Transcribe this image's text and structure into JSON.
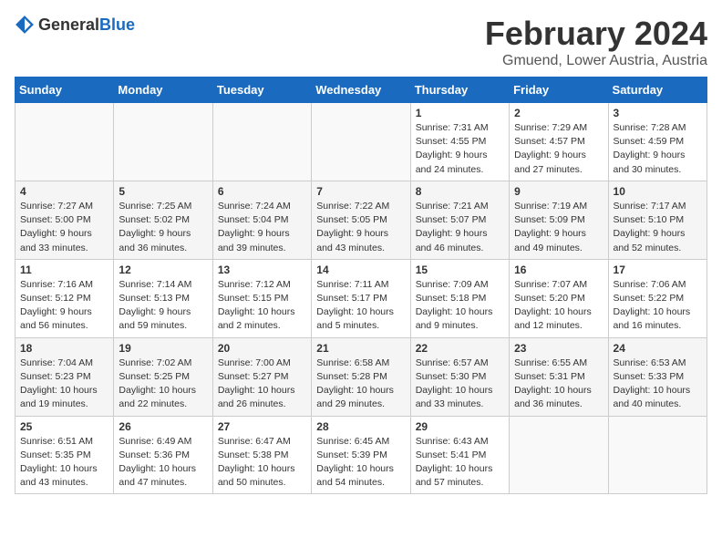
{
  "header": {
    "logo_general": "General",
    "logo_blue": "Blue",
    "title": "February 2024",
    "subtitle": "Gmuend, Lower Austria, Austria"
  },
  "calendar": {
    "days_of_week": [
      "Sunday",
      "Monday",
      "Tuesday",
      "Wednesday",
      "Thursday",
      "Friday",
      "Saturday"
    ],
    "weeks": [
      [
        {
          "day": "",
          "info": ""
        },
        {
          "day": "",
          "info": ""
        },
        {
          "day": "",
          "info": ""
        },
        {
          "day": "",
          "info": ""
        },
        {
          "day": "1",
          "info": "Sunrise: 7:31 AM\nSunset: 4:55 PM\nDaylight: 9 hours\nand 24 minutes."
        },
        {
          "day": "2",
          "info": "Sunrise: 7:29 AM\nSunset: 4:57 PM\nDaylight: 9 hours\nand 27 minutes."
        },
        {
          "day": "3",
          "info": "Sunrise: 7:28 AM\nSunset: 4:59 PM\nDaylight: 9 hours\nand 30 minutes."
        }
      ],
      [
        {
          "day": "4",
          "info": "Sunrise: 7:27 AM\nSunset: 5:00 PM\nDaylight: 9 hours\nand 33 minutes."
        },
        {
          "day": "5",
          "info": "Sunrise: 7:25 AM\nSunset: 5:02 PM\nDaylight: 9 hours\nand 36 minutes."
        },
        {
          "day": "6",
          "info": "Sunrise: 7:24 AM\nSunset: 5:04 PM\nDaylight: 9 hours\nand 39 minutes."
        },
        {
          "day": "7",
          "info": "Sunrise: 7:22 AM\nSunset: 5:05 PM\nDaylight: 9 hours\nand 43 minutes."
        },
        {
          "day": "8",
          "info": "Sunrise: 7:21 AM\nSunset: 5:07 PM\nDaylight: 9 hours\nand 46 minutes."
        },
        {
          "day": "9",
          "info": "Sunrise: 7:19 AM\nSunset: 5:09 PM\nDaylight: 9 hours\nand 49 minutes."
        },
        {
          "day": "10",
          "info": "Sunrise: 7:17 AM\nSunset: 5:10 PM\nDaylight: 9 hours\nand 52 minutes."
        }
      ],
      [
        {
          "day": "11",
          "info": "Sunrise: 7:16 AM\nSunset: 5:12 PM\nDaylight: 9 hours\nand 56 minutes."
        },
        {
          "day": "12",
          "info": "Sunrise: 7:14 AM\nSunset: 5:13 PM\nDaylight: 9 hours\nand 59 minutes."
        },
        {
          "day": "13",
          "info": "Sunrise: 7:12 AM\nSunset: 5:15 PM\nDaylight: 10 hours\nand 2 minutes."
        },
        {
          "day": "14",
          "info": "Sunrise: 7:11 AM\nSunset: 5:17 PM\nDaylight: 10 hours\nand 5 minutes."
        },
        {
          "day": "15",
          "info": "Sunrise: 7:09 AM\nSunset: 5:18 PM\nDaylight: 10 hours\nand 9 minutes."
        },
        {
          "day": "16",
          "info": "Sunrise: 7:07 AM\nSunset: 5:20 PM\nDaylight: 10 hours\nand 12 minutes."
        },
        {
          "day": "17",
          "info": "Sunrise: 7:06 AM\nSunset: 5:22 PM\nDaylight: 10 hours\nand 16 minutes."
        }
      ],
      [
        {
          "day": "18",
          "info": "Sunrise: 7:04 AM\nSunset: 5:23 PM\nDaylight: 10 hours\nand 19 minutes."
        },
        {
          "day": "19",
          "info": "Sunrise: 7:02 AM\nSunset: 5:25 PM\nDaylight: 10 hours\nand 22 minutes."
        },
        {
          "day": "20",
          "info": "Sunrise: 7:00 AM\nSunset: 5:27 PM\nDaylight: 10 hours\nand 26 minutes."
        },
        {
          "day": "21",
          "info": "Sunrise: 6:58 AM\nSunset: 5:28 PM\nDaylight: 10 hours\nand 29 minutes."
        },
        {
          "day": "22",
          "info": "Sunrise: 6:57 AM\nSunset: 5:30 PM\nDaylight: 10 hours\nand 33 minutes."
        },
        {
          "day": "23",
          "info": "Sunrise: 6:55 AM\nSunset: 5:31 PM\nDaylight: 10 hours\nand 36 minutes."
        },
        {
          "day": "24",
          "info": "Sunrise: 6:53 AM\nSunset: 5:33 PM\nDaylight: 10 hours\nand 40 minutes."
        }
      ],
      [
        {
          "day": "25",
          "info": "Sunrise: 6:51 AM\nSunset: 5:35 PM\nDaylight: 10 hours\nand 43 minutes."
        },
        {
          "day": "26",
          "info": "Sunrise: 6:49 AM\nSunset: 5:36 PM\nDaylight: 10 hours\nand 47 minutes."
        },
        {
          "day": "27",
          "info": "Sunrise: 6:47 AM\nSunset: 5:38 PM\nDaylight: 10 hours\nand 50 minutes."
        },
        {
          "day": "28",
          "info": "Sunrise: 6:45 AM\nSunset: 5:39 PM\nDaylight: 10 hours\nand 54 minutes."
        },
        {
          "day": "29",
          "info": "Sunrise: 6:43 AM\nSunset: 5:41 PM\nDaylight: 10 hours\nand 57 minutes."
        },
        {
          "day": "",
          "info": ""
        },
        {
          "day": "",
          "info": ""
        }
      ]
    ]
  }
}
